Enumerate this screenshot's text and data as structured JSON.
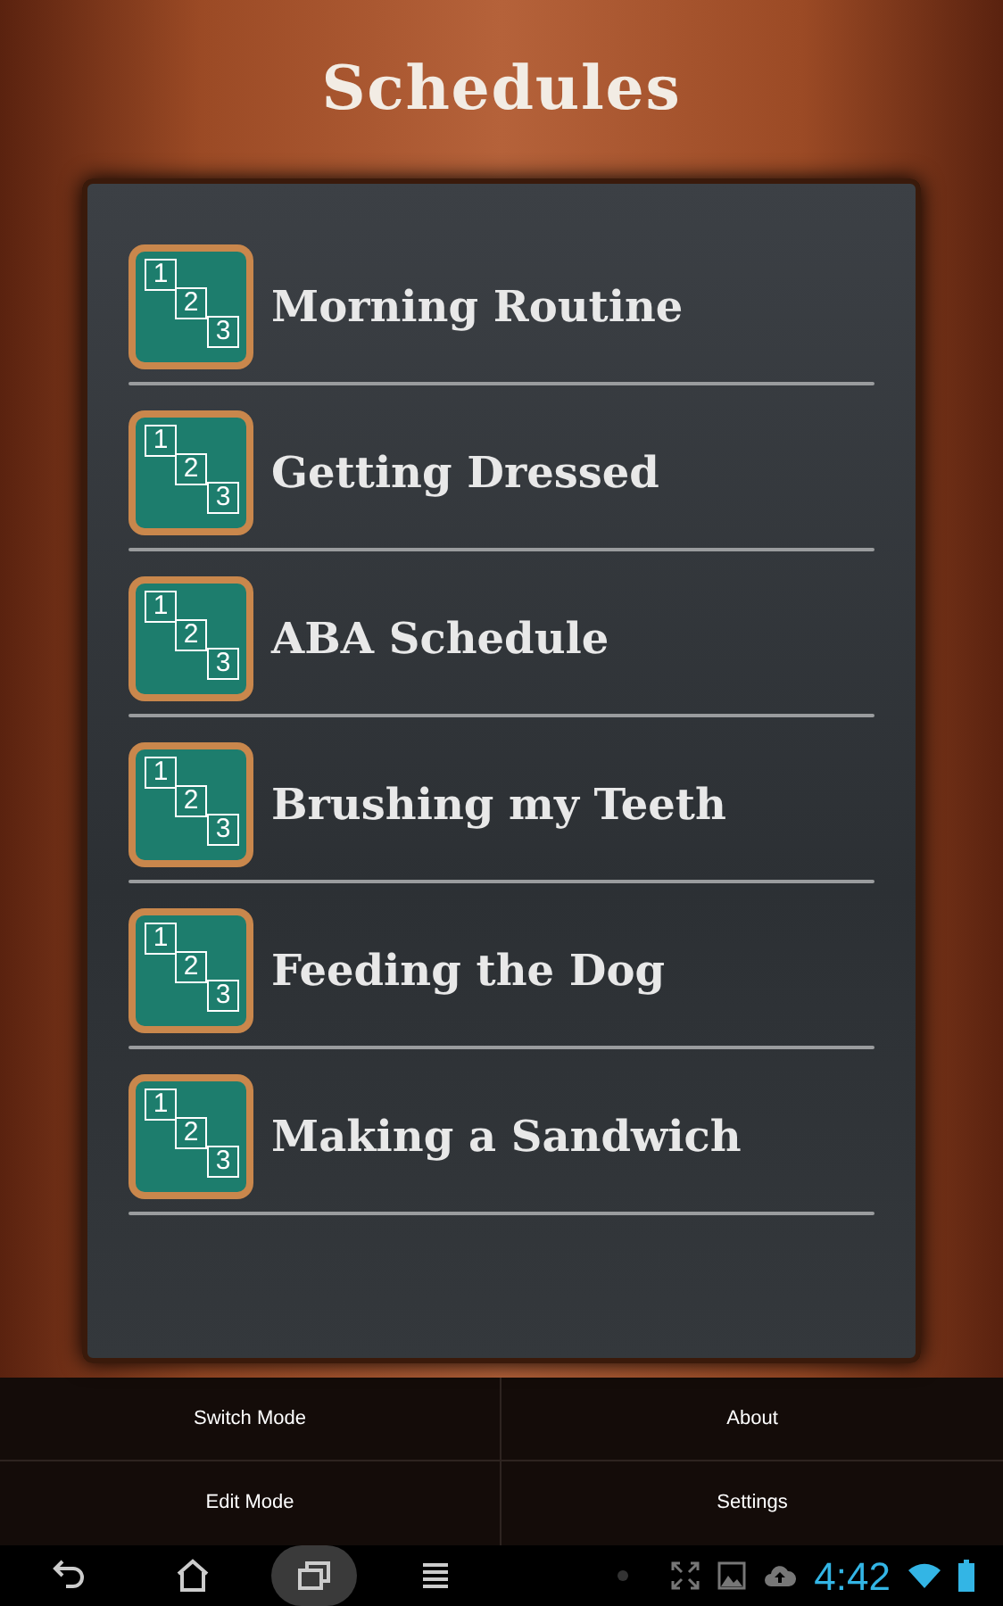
{
  "title": "Schedules",
  "schedules": [
    {
      "label": "Morning Routine",
      "icon_digits": [
        "1",
        "2",
        "3"
      ]
    },
    {
      "label": "Getting Dressed",
      "icon_digits": [
        "1",
        "2",
        "3"
      ]
    },
    {
      "label": "ABA Schedule",
      "icon_digits": [
        "1",
        "2",
        "3"
      ]
    },
    {
      "label": "Brushing my Teeth",
      "icon_digits": [
        "1",
        "2",
        "3"
      ]
    },
    {
      "label": "Feeding the Dog",
      "icon_digits": [
        "1",
        "2",
        "3"
      ]
    },
    {
      "label": "Making a Sandwich",
      "icon_digits": [
        "1",
        "2",
        "3"
      ]
    }
  ],
  "menu": [
    "Switch Mode",
    "About",
    "Edit Mode",
    "Settings"
  ],
  "nav_buttons": [
    {
      "kind": "back",
      "selected": false
    },
    {
      "kind": "home",
      "selected": false
    },
    {
      "kind": "recents",
      "selected": true
    },
    {
      "kind": "menu",
      "selected": false
    }
  ],
  "status_bar": {
    "time": "4:42"
  }
}
